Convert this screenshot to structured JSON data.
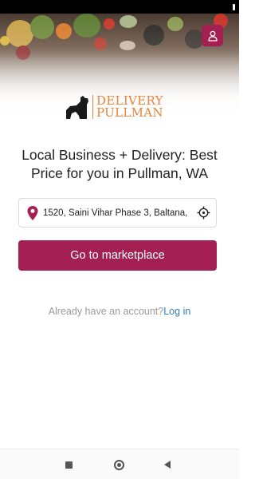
{
  "colors": {
    "brand": "#a41f52",
    "logo_orange": "#e8843a",
    "link": "#2f7fc1",
    "muted_text": "#9a9a9a"
  },
  "header": {
    "account_icon": "user-outline-icon"
  },
  "logo": {
    "line1": "DELIVERY",
    "line2": "PULLMAN"
  },
  "headline": "Local Business + Delivery: Best Price for you in Pullman, WA",
  "location": {
    "pin_icon": "location-pin-icon",
    "value": "1520, Saini Vihar Phase 3, Baltana,",
    "locate_icon": "gps-target-icon"
  },
  "cta": {
    "label": "Go to marketplace"
  },
  "login": {
    "prompt": "Already have an account?",
    "link": "Log in"
  },
  "system_nav": {
    "recents_icon": "square-icon",
    "home_icon": "circle-icon",
    "back_icon": "triangle-back-icon"
  }
}
